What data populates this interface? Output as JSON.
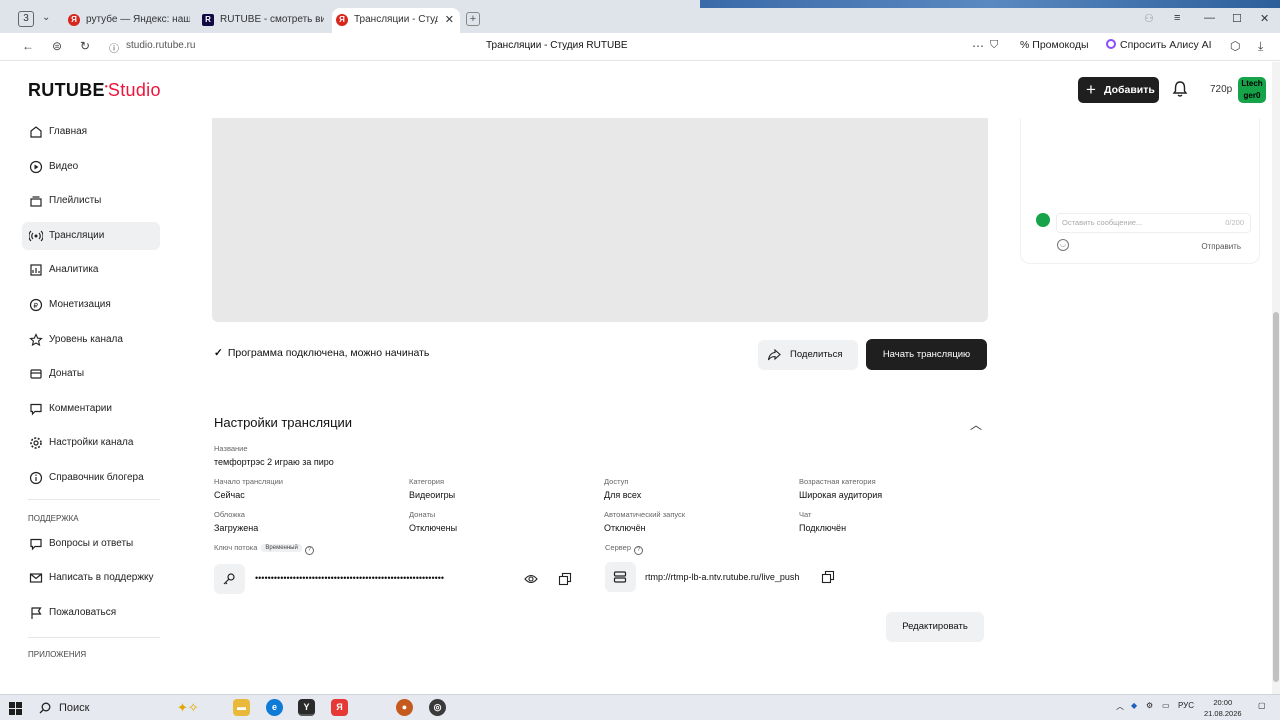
{
  "browser": {
    "tab_count": "3",
    "tabs": [
      {
        "label": "рутубе — Яндекс: нашлось"
      },
      {
        "label": "RUTUBE - смотреть видео"
      },
      {
        "label": "Трансляции - Студия RUTUBE"
      }
    ],
    "url": "studio.rutube.ru",
    "page_title": "Трансляции - Студия RUTUBE",
    "promo_label": "Промокоды",
    "alisa_label": "Спросить Алису AI"
  },
  "header": {
    "logo_main": "RUTUBE",
    "logo_studio": "Studio",
    "add_label": "Добавить",
    "quality": "720p",
    "avatar_text": "Ltech ger0"
  },
  "sidebar": {
    "items": [
      {
        "label": "Главная",
        "icon": "home-icon"
      },
      {
        "label": "Видео",
        "icon": "play-icon"
      },
      {
        "label": "Плейлисты",
        "icon": "playlist-icon"
      },
      {
        "label": "Трансляции",
        "icon": "broadcast-icon"
      },
      {
        "label": "Аналитика",
        "icon": "analytics-icon"
      },
      {
        "label": "Монетизация",
        "icon": "money-icon"
      },
      {
        "label": "Уровень канала",
        "icon": "star-icon"
      },
      {
        "label": "Донаты",
        "icon": "donate-icon"
      },
      {
        "label": "Комментарии",
        "icon": "comment-icon"
      },
      {
        "label": "Настройки канала",
        "icon": "gear-icon"
      },
      {
        "label": "Справочник блогера",
        "icon": "info-icon"
      }
    ],
    "support_title": "ПОДДЕРЖКА",
    "support_items": [
      {
        "label": "Вопросы и ответы",
        "icon": "question-icon"
      },
      {
        "label": "Написать в поддержку",
        "icon": "mail-icon"
      },
      {
        "label": "Пожаловаться",
        "icon": "flag-icon"
      }
    ],
    "apps_title": "ПРИЛОЖЕНИЯ"
  },
  "stream": {
    "status": "Программа подключена, можно начинать",
    "share_label": "Поделиться",
    "start_label": "Начать трансляцию"
  },
  "chat": {
    "placeholder": "Оставить сообщение...",
    "counter": "0/200",
    "send_label": "Отправить"
  },
  "settings": {
    "title": "Настройки трансляции",
    "name_label": "Название",
    "name_value": "темфортрэс 2 играю за пиро",
    "start_label": "Начало трансляции",
    "start_value": "Сейчас",
    "category_label": "Категория",
    "category_value": "Видеоигры",
    "access_label": "Доступ",
    "access_value": "Для всех",
    "age_label": "Возрастная категория",
    "age_value": "Широкая аудитория",
    "cover_label": "Обложка",
    "cover_value": "Загружена",
    "donates_label": "Донаты",
    "donates_value": "Отключены",
    "autostart_label": "Автоматический запуск",
    "autostart_value": "Отключён",
    "chat_label": "Чат",
    "chat_value": "Подключён",
    "key_label": "Ключ потока",
    "key_badge": "Временный",
    "key_value": "••••••••••••••••••••••••••••••••••••••••••••••••••••••••••••",
    "server_label": "Сервер",
    "server_value": "rtmp://rtmp-lb-a.ntv.rutube.ru/live_push",
    "edit_label": "Редактировать"
  },
  "taskbar": {
    "search_label": "Поиск",
    "lang": "РУС",
    "time": "20:00",
    "date": "21.08.2026"
  }
}
